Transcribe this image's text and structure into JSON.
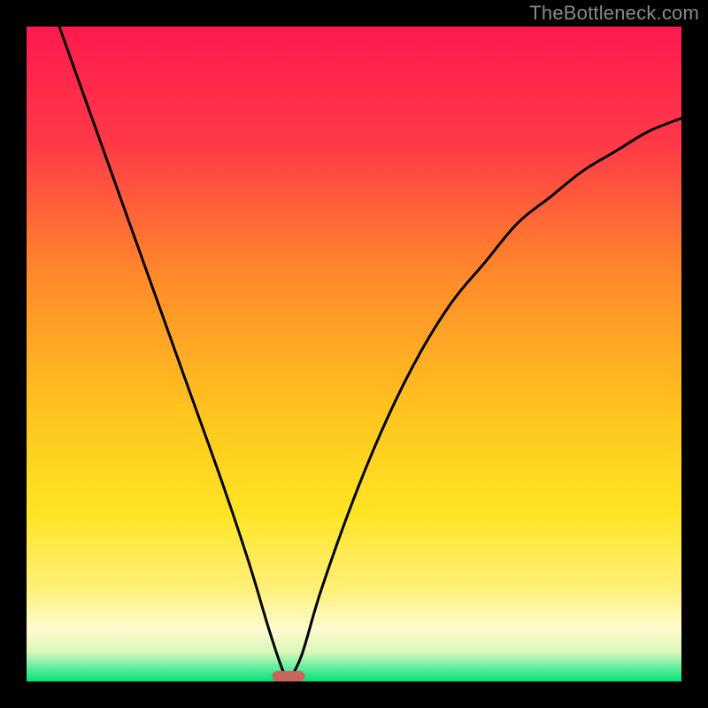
{
  "watermark": "TheBottleneck.com",
  "colors": {
    "top": "#ff1a4f",
    "mid_upper": "#ff8a2a",
    "mid": "#ffe423",
    "mid_lower": "#fff6a8",
    "green": "#00e27a",
    "curve": "#000000",
    "marker": "#c9655c",
    "frame_bg": "#000000"
  },
  "chart_data": {
    "type": "line",
    "title": "",
    "xlabel": "",
    "ylabel": "",
    "xlim": [
      0,
      100
    ],
    "ylim": [
      0,
      100
    ],
    "min_x": 40,
    "series": [
      {
        "name": "left-branch",
        "points": [
          {
            "x": 5,
            "y": 100
          },
          {
            "x": 10,
            "y": 86
          },
          {
            "x": 15,
            "y": 72
          },
          {
            "x": 20,
            "y": 58
          },
          {
            "x": 25,
            "y": 44
          },
          {
            "x": 30,
            "y": 30
          },
          {
            "x": 34,
            "y": 18
          },
          {
            "x": 37,
            "y": 8
          },
          {
            "x": 39,
            "y": 2
          },
          {
            "x": 40,
            "y": 0
          }
        ]
      },
      {
        "name": "right-branch",
        "points": [
          {
            "x": 40,
            "y": 0
          },
          {
            "x": 42,
            "y": 4
          },
          {
            "x": 45,
            "y": 14
          },
          {
            "x": 50,
            "y": 28
          },
          {
            "x": 55,
            "y": 40
          },
          {
            "x": 60,
            "y": 50
          },
          {
            "x": 65,
            "y": 58
          },
          {
            "x": 70,
            "y": 64
          },
          {
            "x": 75,
            "y": 70
          },
          {
            "x": 80,
            "y": 74
          },
          {
            "x": 85,
            "y": 78
          },
          {
            "x": 90,
            "y": 81
          },
          {
            "x": 95,
            "y": 84
          },
          {
            "x": 100,
            "y": 86
          }
        ]
      }
    ],
    "marker": {
      "x": 40,
      "y": 0,
      "w": 5,
      "h": 1.6
    }
  }
}
